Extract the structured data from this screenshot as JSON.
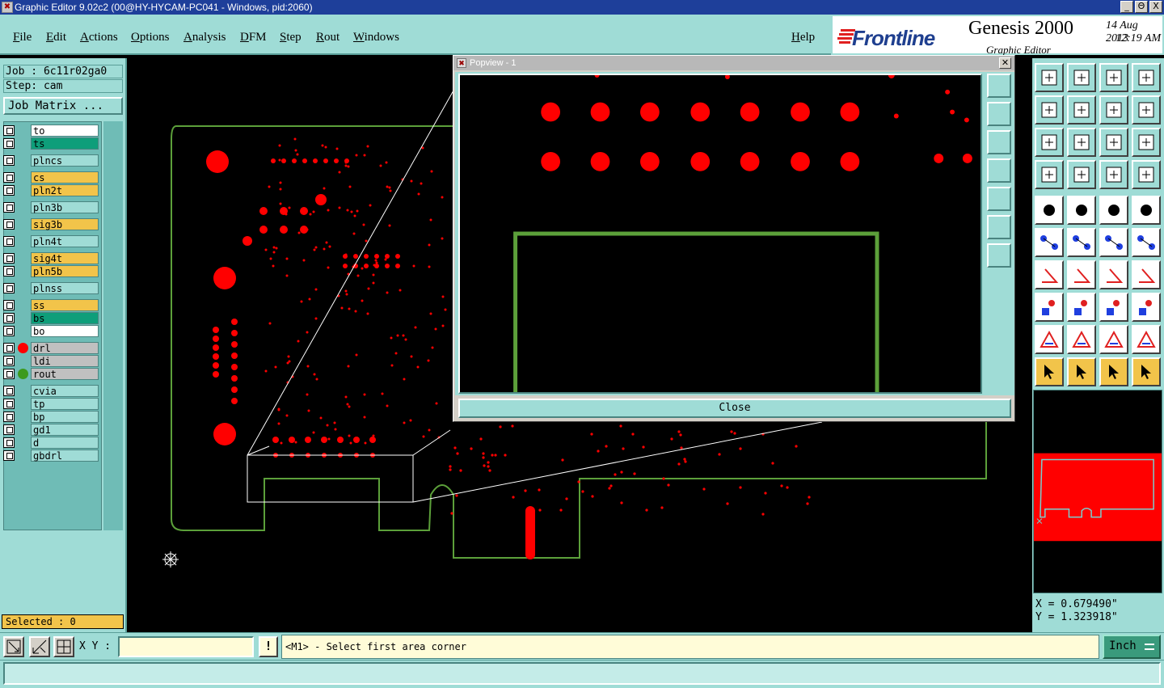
{
  "window": {
    "title": "Graphic Editor 9.02c2 (00@HY-HYCAM-PC041 - Windows, pid:2060)",
    "minimize": "_",
    "restore": "Θ",
    "close": "X"
  },
  "menu": [
    "File",
    "Edit",
    "Actions",
    "Options",
    "Analysis",
    "DFM",
    "Step",
    "Rout",
    "Windows"
  ],
  "help_label": "Help",
  "brand": {
    "logo": "Frontline",
    "product": "Genesis 2000",
    "subtitle": "Graphic Editor",
    "date": "14 Aug 2013",
    "time": "12:19 AM"
  },
  "job": {
    "job_line": "Job : 6c11r02ga0",
    "step_line": "Step: cam",
    "matrix_button": "Job Matrix ..."
  },
  "layers": [
    {
      "name": "to",
      "color": "#ffffff"
    },
    {
      "name": "ts",
      "color": "#0e9e7a"
    },
    {
      "name": "plncs",
      "color": "#9fdcd6"
    },
    {
      "name": "cs",
      "color": "#f2c44a"
    },
    {
      "name": "pln2t",
      "color": "#f2c44a"
    },
    {
      "name": "pln3b",
      "color": "#9fdcd6"
    },
    {
      "name": "sig3b",
      "color": "#f2c44a"
    },
    {
      "name": "pln4t",
      "color": "#9fdcd6"
    },
    {
      "name": "sig4t",
      "color": "#f2c44a"
    },
    {
      "name": "pln5b",
      "color": "#f2c44a"
    },
    {
      "name": "plnss",
      "color": "#9fdcd6"
    },
    {
      "name": "ss",
      "color": "#f2c44a"
    },
    {
      "name": "bs",
      "color": "#0e9e7a"
    },
    {
      "name": "bo",
      "color": "#ffffff"
    },
    {
      "name": "drl",
      "color": "#c0c0c0",
      "display": "#ff0000"
    },
    {
      "name": "ldi",
      "color": "#c0c0c0"
    },
    {
      "name": "rout",
      "color": "#c0c0c0",
      "display": "#3c9a1e"
    },
    {
      "name": "cvia",
      "color": "#9fdcd6"
    },
    {
      "name": "tp",
      "color": "#9fdcd6"
    },
    {
      "name": "bp",
      "color": "#9fdcd6"
    },
    {
      "name": "gd1",
      "color": "#9fdcd6"
    },
    {
      "name": "d",
      "color": "#9fdcd6"
    },
    {
      "name": "gbdrl",
      "color": "#9fdcd6"
    }
  ],
  "selected_label": "Selected : 0",
  "popview": {
    "title": "Popview - 1",
    "close_button": "Close"
  },
  "coords": {
    "x": "X = 0.679490\"",
    "y": "Y = 1.323918\""
  },
  "command": {
    "xy_label": "X Y :",
    "xy_value": "",
    "bang": "!",
    "message": "<M1> - Select first area corner",
    "units": "Inch"
  },
  "colors": {
    "panel": "#9fdcd6",
    "drill": "#ff0000",
    "rout": "#3c9a1e",
    "outline": "#5ca03a",
    "active_orange": "#f2c44a"
  }
}
